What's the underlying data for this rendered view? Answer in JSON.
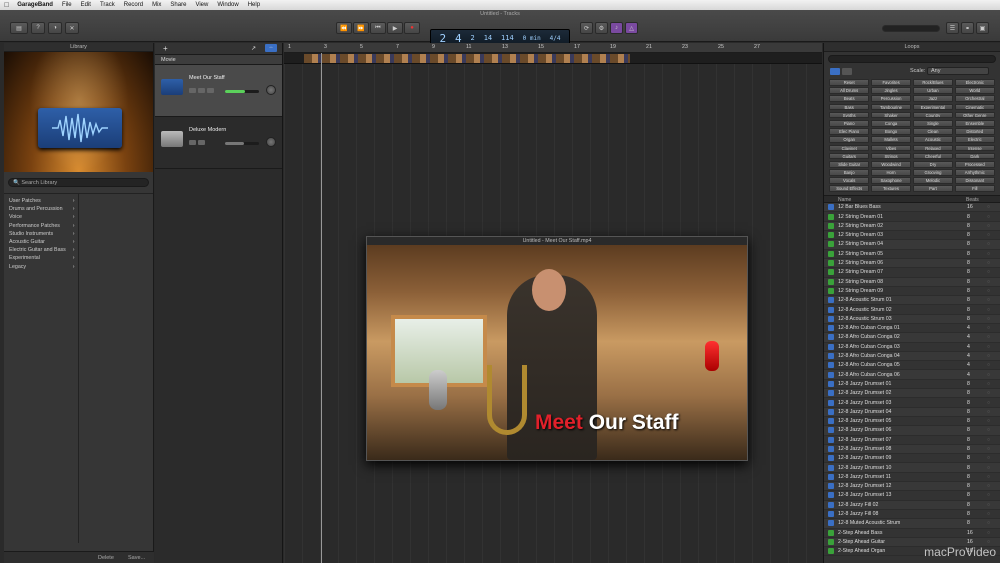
{
  "menubar": {
    "items": [
      "GarageBand",
      "File",
      "Edit",
      "Track",
      "Record",
      "Mix",
      "Share",
      "View",
      "Window",
      "Help"
    ]
  },
  "window": {
    "title": "Untitled - Tracks"
  },
  "lcd": {
    "bar": "2",
    "beat": "4",
    "sub": "2",
    "tempo": "114",
    "bpm": "14",
    "time": "0 min",
    "key": "4/4"
  },
  "library": {
    "title": "Library",
    "search_placeholder": "Search Library",
    "categories": [
      "User Patches",
      "Drums and Percussion",
      "Voice",
      "Performance Patches",
      "Studio Instruments",
      "Acoustic Guitar",
      "Electric Guitar and Bass",
      "Experimental",
      "Legacy"
    ],
    "delete_label": "Delete",
    "save_label": "Save..."
  },
  "tracks": {
    "movie_label": "Movie",
    "list": [
      {
        "name": "Meet Our Staff"
      },
      {
        "name": "Deluxe Modern"
      }
    ]
  },
  "ruler": {
    "marks": [
      "1",
      "3",
      "5",
      "7",
      "9",
      "11",
      "13",
      "15",
      "17",
      "19",
      "21",
      "23",
      "25",
      "27"
    ]
  },
  "video": {
    "title": "Untitled - Meet Our Staff.mp4",
    "caption_red": "Meet",
    "caption_white": "Our Staff"
  },
  "loops": {
    "title": "Loops",
    "scale_label": "Scale:",
    "scale_value": "Any",
    "buttons": [
      "Reset",
      "Favorites",
      "Rock/Blues",
      "Electronic",
      "All Drums",
      "Jingles",
      "Urban",
      "World",
      "Beats",
      "Percussion",
      "Jazz",
      "Orchestral",
      "Bass",
      "Tambourine",
      "Experimental",
      "Cinematic",
      "Synths",
      "Shaker",
      "Country",
      "Other Genre",
      "Piano",
      "Conga",
      "Single",
      "Ensemble",
      "Elec Piano",
      "Bongo",
      "Clean",
      "Distorted",
      "Organ",
      "Mallets",
      "Acoustic",
      "Electric",
      "Clavinet",
      "Vibes",
      "Relaxed",
      "Intense",
      "Guitars",
      "Strings",
      "Cheerful",
      "Dark",
      "Slide Guitar",
      "Woodwind",
      "Dry",
      "Processed",
      "Banjo",
      "Horn",
      "Grooving",
      "Arrhythmic",
      "Vocals",
      "Saxophone",
      "Melodic",
      "Dissonant",
      "Sound Effects",
      "Textures",
      "Part",
      "Fill"
    ],
    "col_name": "Name",
    "col_beats": "Beats",
    "items": [
      {
        "name": "12 Bar Blues Bass",
        "beats": "16",
        "color": "b"
      },
      {
        "name": "12 String Dream 01",
        "beats": "8",
        "color": "g"
      },
      {
        "name": "12 String Dream 02",
        "beats": "8",
        "color": "g"
      },
      {
        "name": "12 String Dream 03",
        "beats": "8",
        "color": "g"
      },
      {
        "name": "12 String Dream 04",
        "beats": "8",
        "color": "g"
      },
      {
        "name": "12 String Dream 05",
        "beats": "8",
        "color": "g"
      },
      {
        "name": "12 String Dream 06",
        "beats": "8",
        "color": "g"
      },
      {
        "name": "12 String Dream 07",
        "beats": "8",
        "color": "g"
      },
      {
        "name": "12 String Dream 08",
        "beats": "8",
        "color": "g"
      },
      {
        "name": "12 String Dream 09",
        "beats": "8",
        "color": "g"
      },
      {
        "name": "12-8 Acoustic Strum 01",
        "beats": "8",
        "color": "b"
      },
      {
        "name": "12-8 Acoustic Strum 02",
        "beats": "8",
        "color": "b"
      },
      {
        "name": "12-8 Acoustic Strum 03",
        "beats": "8",
        "color": "b"
      },
      {
        "name": "12-8 Afro Cuban Conga 01",
        "beats": "4",
        "color": "b"
      },
      {
        "name": "12-8 Afro Cuban Conga 02",
        "beats": "4",
        "color": "b"
      },
      {
        "name": "12-8 Afro Cuban Conga 03",
        "beats": "4",
        "color": "b"
      },
      {
        "name": "12-8 Afro Cuban Conga 04",
        "beats": "4",
        "color": "b"
      },
      {
        "name": "12-8 Afro Cuban Conga 05",
        "beats": "4",
        "color": "b"
      },
      {
        "name": "12-8 Afro Cuban Conga 06",
        "beats": "4",
        "color": "b"
      },
      {
        "name": "12-8 Jazzy Drumset 01",
        "beats": "8",
        "color": "b"
      },
      {
        "name": "12-8 Jazzy Drumset 02",
        "beats": "8",
        "color": "b"
      },
      {
        "name": "12-8 Jazzy Drumset 03",
        "beats": "8",
        "color": "b"
      },
      {
        "name": "12-8 Jazzy Drumset 04",
        "beats": "8",
        "color": "b"
      },
      {
        "name": "12-8 Jazzy Drumset 05",
        "beats": "8",
        "color": "b"
      },
      {
        "name": "12-8 Jazzy Drumset 06",
        "beats": "8",
        "color": "b"
      },
      {
        "name": "12-8 Jazzy Drumset 07",
        "beats": "8",
        "color": "b"
      },
      {
        "name": "12-8 Jazzy Drumset 08",
        "beats": "8",
        "color": "b"
      },
      {
        "name": "12-8 Jazzy Drumset 09",
        "beats": "8",
        "color": "b"
      },
      {
        "name": "12-8 Jazzy Drumset 10",
        "beats": "8",
        "color": "b"
      },
      {
        "name": "12-8 Jazzy Drumset 11",
        "beats": "8",
        "color": "b"
      },
      {
        "name": "12-8 Jazzy Drumset 12",
        "beats": "8",
        "color": "b"
      },
      {
        "name": "12-8 Jazzy Drumset 13",
        "beats": "8",
        "color": "b"
      },
      {
        "name": "12-8 Jazzy Fill 02",
        "beats": "8",
        "color": "b"
      },
      {
        "name": "12-8 Jazzy Fill 08",
        "beats": "8",
        "color": "b"
      },
      {
        "name": "12-8 Muted Acoustic Strum",
        "beats": "8",
        "color": "b"
      },
      {
        "name": "2-Step Ahead Bass",
        "beats": "16",
        "color": "g"
      },
      {
        "name": "2-Step Ahead Guitar",
        "beats": "16",
        "color": "g"
      },
      {
        "name": "2-Step Ahead Organ",
        "beats": "16",
        "color": "g"
      }
    ]
  },
  "watermark": "macProVideo"
}
